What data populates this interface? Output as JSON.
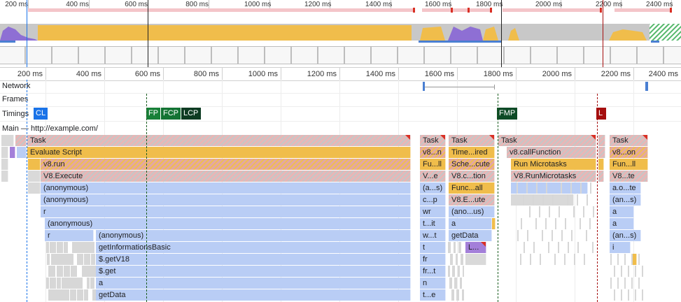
{
  "overview": {
    "ticks": [
      "200 ms",
      "400 ms",
      "600 ms",
      "800 ms",
      "1000 ms",
      "1200 ms",
      "1400 ms",
      "1600 ms",
      "1800 ms",
      "2000 ms",
      "2200 ms",
      "2400 ms"
    ]
  },
  "ruler": {
    "ticks": [
      "200 ms",
      "400 ms",
      "600 ms",
      "800 ms",
      "1000 ms",
      "1200 ms",
      "1400 ms",
      "1600 ms",
      "1800 ms",
      "2000 ms",
      "2200 ms",
      "2400 ms"
    ]
  },
  "tracks": {
    "network": "Network",
    "frames": "Frames",
    "timings": "Timings",
    "main": "Main",
    "main_url": "— http://example.com/"
  },
  "timings": {
    "dcl": "CL",
    "fp": "FP",
    "fcp": "FCP",
    "lcp": "LCP",
    "fmp": "FMP",
    "l": "L"
  },
  "colors": {
    "dcl": "#1a73e8",
    "fp": "#188038",
    "fcp": "#137333",
    "lcp": "#0d3b22",
    "fmp": "#0d4a26",
    "l": "#a50e0e",
    "task_red": "#d93025",
    "script_yellow": "#f0bd4b",
    "function_blue": "#b9cdf5"
  },
  "flame": {
    "col1": {
      "task": "Task",
      "evaluate": "Evaluate Script",
      "v8run": "v8.run",
      "v8execute": "V8.Execute",
      "anon1": "(anonymous)",
      "anon2": "(anonymous)",
      "r1": "r",
      "anon3": "(anonymous)",
      "r2": "r",
      "anon4": "(anonymous)",
      "getInfo": "getInformationsBasic",
      "getV18": "$.getV18",
      "get": "$.get",
      "a": "a",
      "getData": "getData"
    },
    "col2": {
      "task": "Task",
      "r1": "v8...n",
      "r2": "Fu...ll",
      "r3": "V...e",
      "r4": "(a...s)",
      "r5": "c...p",
      "r6": "wr",
      "r7": "t...it",
      "r8": "w...t",
      "r9": "t",
      "r10": "fr",
      "r11": "fr...t",
      "r12": "n",
      "r13": "t...e"
    },
    "col3": {
      "task": "Task",
      "r1": "Time...ired",
      "r2": "Sche...cute",
      "r3": "V8.c...tion",
      "r4": "Func...all",
      "r5": "V8.E...ute",
      "r6": "(ano...us)",
      "r7": "a",
      "r8": "getData",
      "r9": "L..."
    },
    "col4": {
      "task": "Task",
      "r1": "v8.callFunction",
      "r2": "Run Microtasks",
      "r3": "V8.RunMicrotasks"
    },
    "col5": {
      "task": "Task",
      "r1": "v8...on",
      "r2": "Fun...ll",
      "r3": "V8...te",
      "r4": "a.o...te",
      "r5": "(an...s)",
      "r6": "a",
      "r7": "a",
      "r8": "(an...s)",
      "r9": "i"
    }
  }
}
